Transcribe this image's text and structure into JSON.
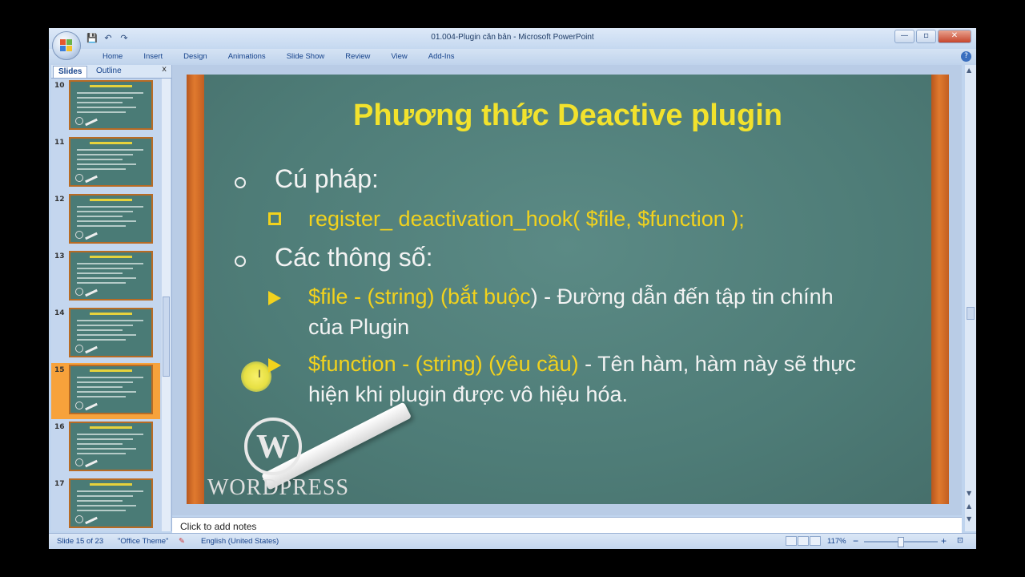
{
  "window": {
    "title": "01.004-Plugin căn bản - Microsoft PowerPoint",
    "controls": [
      "—",
      "▫",
      "✕"
    ]
  },
  "quick_access": {
    "save": "💾",
    "undo": "↶",
    "redo": "↷"
  },
  "ribbon": {
    "tabs": [
      "Home",
      "Insert",
      "Design",
      "Animations",
      "Slide Show",
      "Review",
      "View",
      "Add-Ins"
    ]
  },
  "panel": {
    "tabs": [
      "Slides",
      "Outline"
    ],
    "close": "x",
    "thumbnails": [
      {
        "num": "10",
        "selected": false
      },
      {
        "num": "11",
        "selected": false
      },
      {
        "num": "12",
        "selected": false
      },
      {
        "num": "13",
        "selected": false
      },
      {
        "num": "14",
        "selected": false
      },
      {
        "num": "15",
        "selected": true
      },
      {
        "num": "16",
        "selected": false
      },
      {
        "num": "17",
        "selected": false
      }
    ]
  },
  "slide": {
    "title": "Phương thức Deactive plugin",
    "syntax_label": "Cú pháp:",
    "syntax_code": "register_ deactivation_hook( $file, $function );",
    "params_label": "Các thông số:",
    "param1_name": "$file - (string) (bắt buộc",
    "param1_close": ")",
    "param1_desc_a": " - Đường dẫn đến tập tin chính",
    "param1_desc_b": "của Plugin",
    "param2_name": "$function - (string) (yêu cầu)",
    "param2_desc_a": " - Tên hàm, hàm này sẽ thực",
    "param2_desc_b": "hiện khi plugin được vô hiệu hóa.",
    "logo_letter": "W",
    "logo_word": "WORDPRESS",
    "cursor": "I"
  },
  "notes": {
    "placeholder": "Click to add notes"
  },
  "status": {
    "slide_pos": "Slide 15 of 23",
    "theme": "\"Office Theme\"",
    "language": "English (United States)",
    "zoom": "117%",
    "zoom_out": "−",
    "zoom_in": "+"
  },
  "colors": {
    "board": "#51807b",
    "frame": "#e07a2e",
    "title_yellow": "#f2e22d",
    "selection": "#f7a23b"
  }
}
